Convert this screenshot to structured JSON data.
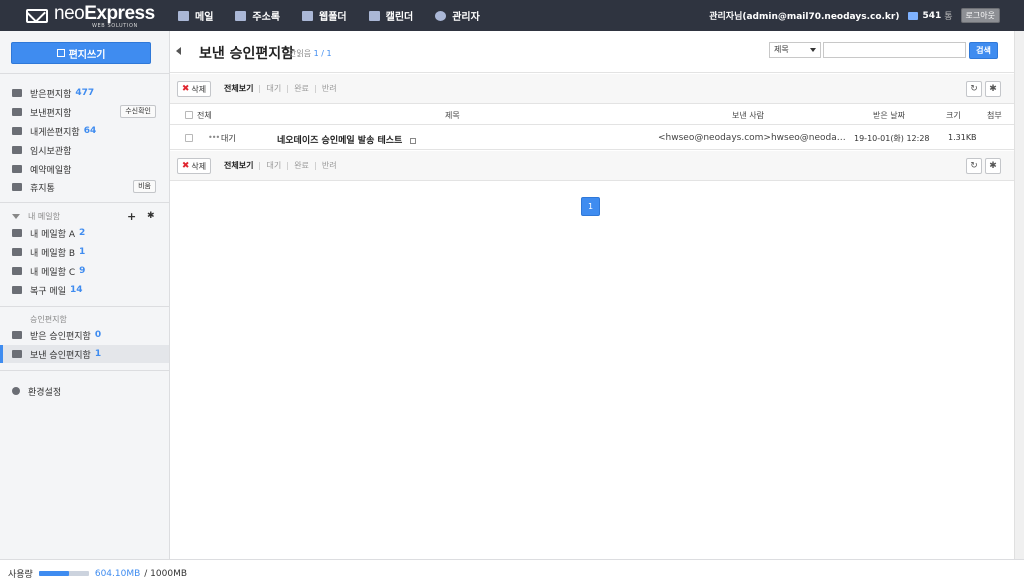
{
  "app": {
    "logo_neo": "neo",
    "logo_express": "Express",
    "logo_sub": "WEB SOLUTION"
  },
  "topnav": [
    {
      "label": "메일",
      "icon": "mail-icon"
    },
    {
      "label": "주소록",
      "icon": "book-icon"
    },
    {
      "label": "웹폴더",
      "icon": "drive-icon"
    },
    {
      "label": "캘린더",
      "icon": "calendar-icon"
    },
    {
      "label": "관리자",
      "icon": "gear-icon"
    }
  ],
  "user": {
    "name": "관리자님(admin@mail70.neodays.co.kr)",
    "mail_count": "541",
    "mail_unit": "통",
    "logout_label": "로그아웃"
  },
  "sidebar": {
    "compose_label": "편지쓰기",
    "folders": [
      {
        "label": "받은편지함",
        "count": "477",
        "icon": "inbox-icon"
      },
      {
        "label": "보낸편지함",
        "count": "",
        "icon": "folder-icon",
        "button": "수신확인"
      },
      {
        "label": "내게쓴편지함",
        "count": "64",
        "icon": "folder-icon"
      },
      {
        "label": "임시보관함",
        "count": "",
        "icon": "folder-icon"
      },
      {
        "label": "예약메일함",
        "count": "",
        "icon": "folder-icon"
      },
      {
        "label": "휴지통",
        "count": "",
        "icon": "trash-icon",
        "button": "비움"
      }
    ],
    "my_mailbox_title": "내 메일함",
    "my_folders": [
      {
        "label": "내 메일함 A",
        "count": "2"
      },
      {
        "label": "내 메일함 B",
        "count": "1"
      },
      {
        "label": "내 메일함 C",
        "count": "9"
      },
      {
        "label": "복구 메일",
        "count": "14"
      }
    ],
    "approval_title": "승인편지함",
    "approval_folders": [
      {
        "label": "받은 승인편지함",
        "count": "0"
      },
      {
        "label": "보낸 승인편지함",
        "count": "1"
      }
    ],
    "settings_label": "환경설정"
  },
  "main": {
    "title": "보낸 승인편지함",
    "unread_label": "안읽음",
    "unread_value": "1 / 1",
    "search_select": "제목",
    "search_placeholder": "",
    "search_btn": "검색",
    "delete_label": "삭제",
    "filters": [
      "전체보기",
      "대기",
      "완료",
      "반려"
    ],
    "columns": {
      "all": "전체",
      "subject": "제목",
      "sender": "보낸 사람",
      "date": "받은 날짜",
      "size": "크기",
      "attach": "첨부"
    },
    "rows": [
      {
        "status": "대기",
        "subject": "네오데이즈 승인메일 발송 테스트",
        "sender": "<hwseo@neodays.com>hwseo@neodays.com",
        "date": "19-10-01(화) 12:28",
        "size": "1.31KB"
      }
    ],
    "page": "1"
  },
  "usage": {
    "label": "사용량",
    "used": "604.10MB",
    "total": "/ 1000MB",
    "fraction": 0.604
  }
}
